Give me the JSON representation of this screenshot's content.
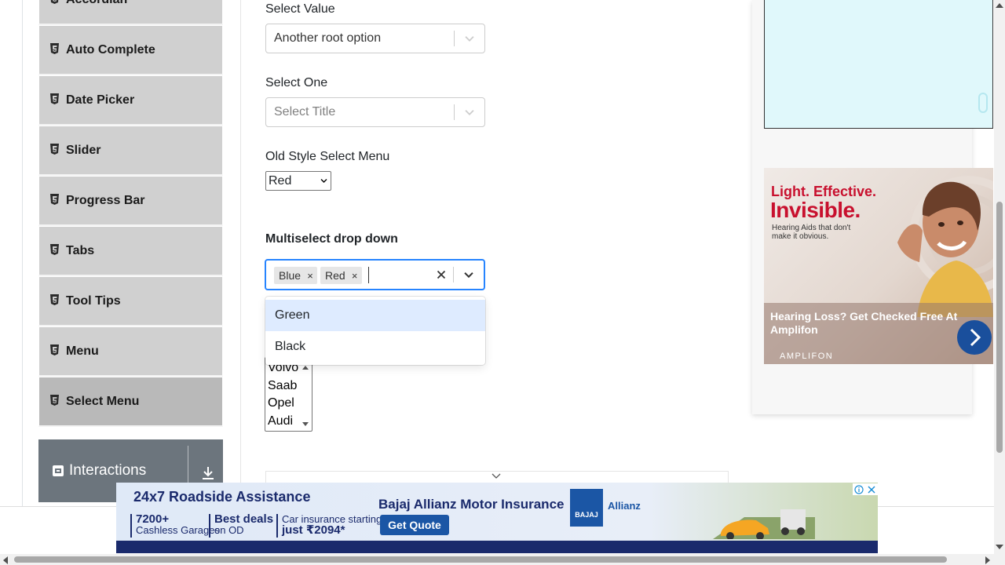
{
  "sidebar": {
    "items": [
      {
        "label": "Accordian"
      },
      {
        "label": "Auto Complete"
      },
      {
        "label": "Date Picker"
      },
      {
        "label": "Slider"
      },
      {
        "label": "Progress Bar"
      },
      {
        "label": "Tabs"
      },
      {
        "label": "Tool Tips"
      },
      {
        "label": "Menu"
      },
      {
        "label": "Select Menu"
      }
    ],
    "active_item": "Select Menu",
    "group_header": {
      "label": "Interactions",
      "icon": "interactions-icon",
      "expand_icon": "download-arrow-icon"
    }
  },
  "form": {
    "select_value": {
      "label": "Select Value",
      "value": "Another root option"
    },
    "select_one": {
      "label": "Select One",
      "placeholder": "Select Title"
    },
    "old_style": {
      "label": "Old Style Select Menu",
      "value": "Red"
    },
    "multiselect": {
      "label": "Multiselect drop down",
      "chips": [
        "Blue",
        "Red"
      ],
      "remove_glyph": "×",
      "menu_options": [
        "Green",
        "Black"
      ],
      "focused_option": "Green"
    },
    "standard_multiselect": {
      "options": [
        "Volvo",
        "Saab",
        "Opel",
        "Audi"
      ]
    }
  },
  "ads": {
    "hearing": {
      "headline_1": "Light. Effective.",
      "headline_2": "Invisible.",
      "sub": "Hearing Aids that don't make it obvious.",
      "title": "Hearing Loss? Get Checked Free At Amplifon",
      "brand": "AMPLIFON"
    },
    "banner": {
      "title": "24x7 Roadside Assistance",
      "brand": "Bajaj Allianz Motor Insurance",
      "stat1_big": "7200+",
      "stat1_small": "Cashless Garages",
      "stat2_big": "Best deals",
      "stat2_small": "on OD",
      "stat3_small": "Car insurance starting",
      "stat3_big": "just ₹2094*",
      "cta": "Get Quote",
      "logo_text": "BAJAJ",
      "partner": "Allianz"
    }
  },
  "colors": {
    "focus_border": "#2684ff",
    "option_focus_bg": "#deebff",
    "sidebar_item_bg": "#d0d0d0",
    "group_header_bg": "#6c757d"
  }
}
